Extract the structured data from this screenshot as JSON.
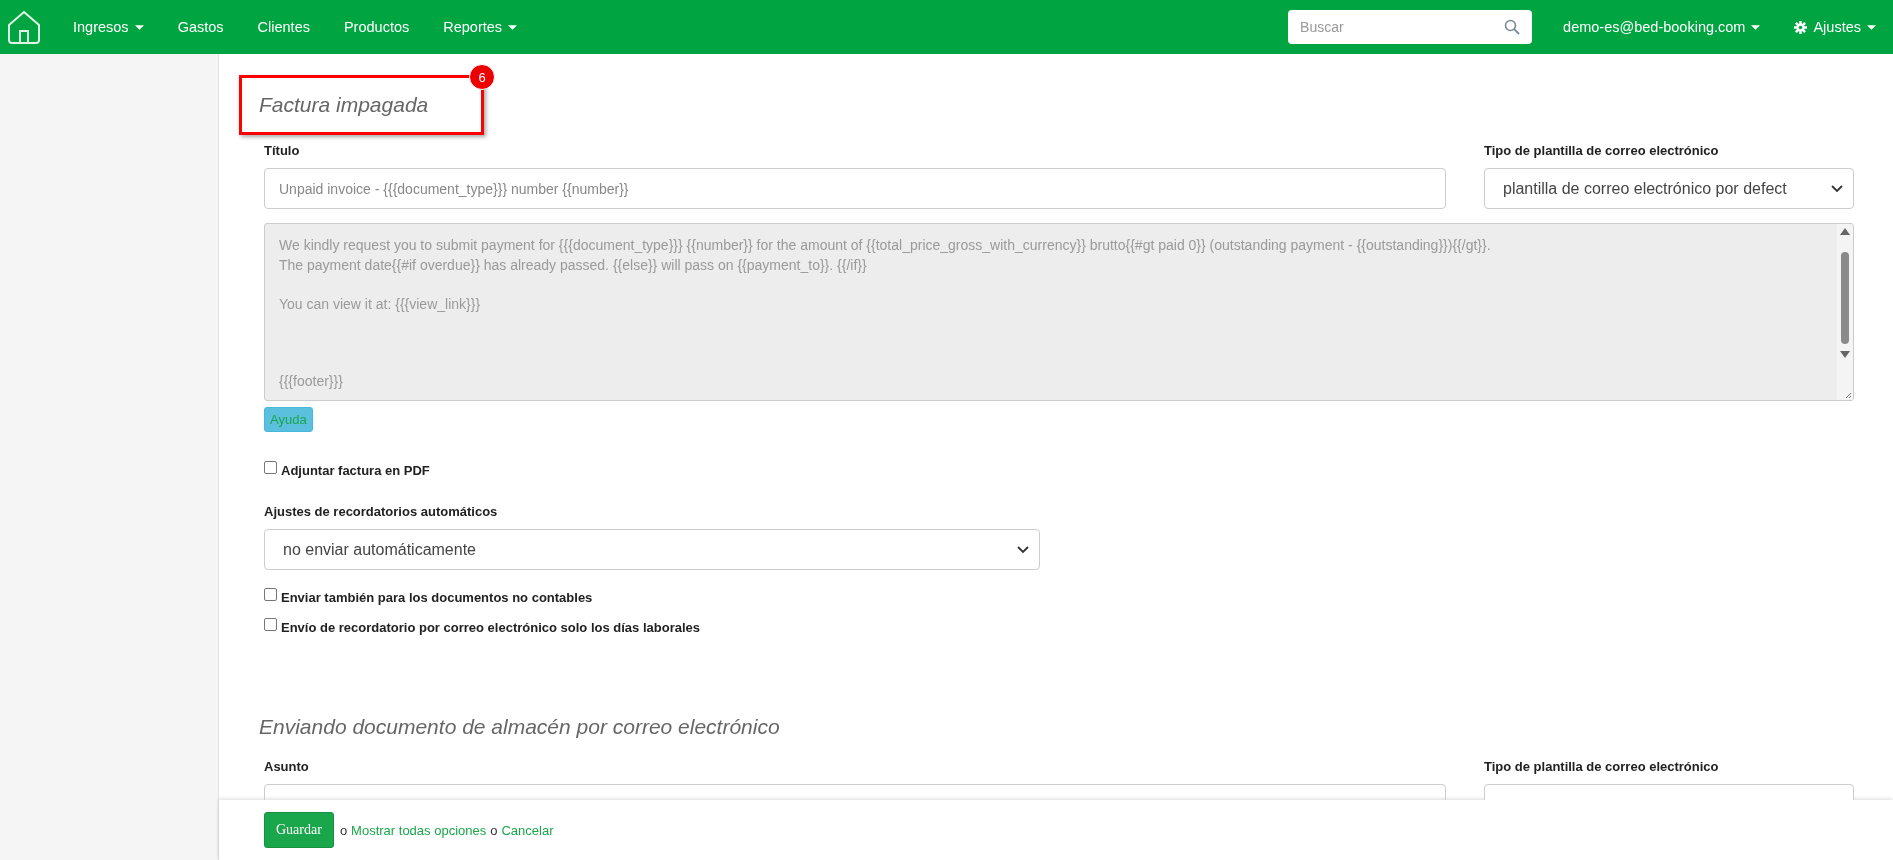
{
  "navbar": {
    "menu": [
      {
        "label": "Ingresos",
        "dropdown": true
      },
      {
        "label": "Gastos",
        "dropdown": false
      },
      {
        "label": "Clientes",
        "dropdown": false
      },
      {
        "label": "Productos",
        "dropdown": false
      },
      {
        "label": "Reportes",
        "dropdown": true
      }
    ],
    "search": {
      "placeholder": "Buscar"
    },
    "account": {
      "label": "demo-es@bed-booking.com",
      "dropdown": true
    },
    "settings": {
      "label": "Ajustes",
      "dropdown": true
    }
  },
  "unpaid_section": {
    "heading": "Factura impagada",
    "annotation_badge": "6",
    "title_label": "Título",
    "title_value": "Unpaid invoice - {{{document_type}}} number {{number}}",
    "template_label": "Tipo de plantilla de correo electrónico",
    "template_value": "plantilla de correo electrónico por defect",
    "body_paragraphs": [
      {
        "kind": "text",
        "lines": [
          "We kindly request you to submit payment for {{{document_type}}} {{number}} for the amount of {{total_price_gross_with_currency}} brutto{{#gt paid 0}} (outstanding payment - {{outstanding}}){{/gt}}.",
          "The payment date{{#if overdue}} has already passed. {{else}} will pass on {{payment_to}}. {{/if}}"
        ]
      },
      {
        "kind": "text",
        "lines": [
          "You can view it at: {{{view_link}}}"
        ]
      },
      {
        "kind": "signature",
        "lines": [
          "{{{footer}}}"
        ]
      }
    ],
    "help_button": "Ayuda",
    "attach_pdf": {
      "label": "Adjuntar factura en PDF",
      "checked": false
    },
    "reminders_label": "Ajustes de recordatorios automáticos",
    "reminders_value": "no enviar automáticamente",
    "options": [
      {
        "label": "Enviar también para los documentos no contables",
        "checked": false
      },
      {
        "label": "Envío de recordatorio por correo electrónico solo los días laborales",
        "checked": false
      }
    ]
  },
  "warehouse_section": {
    "heading": "Enviando documento de almacén por correo electrónico",
    "subject_label": "Asunto",
    "template_label": "Tipo de plantilla de correo electrónico"
  },
  "footer": {
    "save_button": "Guardar",
    "separator_1": "o",
    "show_all_link": "Mostrar todas opciones",
    "separator_2": "o",
    "cancel_link": "Cancelar"
  }
}
